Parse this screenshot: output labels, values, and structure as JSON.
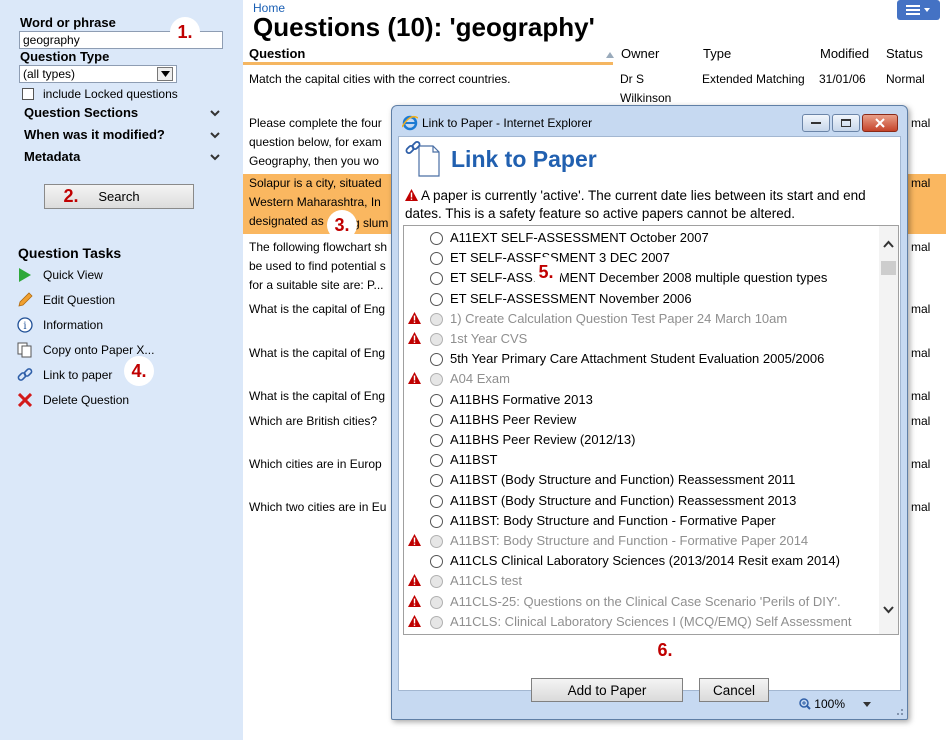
{
  "sidebar": {
    "word_label": "Word or phrase",
    "word_value": "geography",
    "type_label": "Question Type",
    "type_value": "(all types)",
    "locked_label": "include Locked questions",
    "sections": [
      "Question Sections",
      "When was it modified?",
      "Metadata"
    ],
    "search_label": "Search",
    "tasks_title": "Question Tasks",
    "tasks": [
      {
        "label": "Quick View",
        "icon": "play-icon"
      },
      {
        "label": "Edit Question",
        "icon": "pencil-icon"
      },
      {
        "label": "Information",
        "icon": "info-icon"
      },
      {
        "label": "Copy onto Paper X...",
        "icon": "copy-icon"
      },
      {
        "label": "Link to paper",
        "icon": "link-icon"
      },
      {
        "label": "Delete Question",
        "icon": "delete-x-icon"
      }
    ]
  },
  "callouts": [
    "1.",
    "2.",
    "3.",
    "4.",
    "5.",
    "6."
  ],
  "main": {
    "breadcrumb": "Home",
    "title": "Questions (10): 'geography'",
    "columns": [
      "Question",
      "Owner",
      "Type",
      "Modified",
      "Status"
    ],
    "rows": [
      {
        "q": "Match the capital cities with the correct countries.",
        "owner": "Dr S Wilkinson",
        "type": "Extended Matching",
        "modified": "31/01/06",
        "status": "Normal"
      },
      {
        "q": "Please complete the four question below, for exam Geography, then you wo",
        "status": "mal"
      },
      {
        "q": "Solapur is a city, situated Western Maharashtra, In designated as",
        "q_tail": "g slum",
        "status": "mal"
      },
      {
        "q": "The following flowchart sh be used to find potential s for a suitable site are: P...",
        "status": "mal"
      },
      {
        "q": "What is the capital of Eng",
        "status": "mal"
      },
      {
        "q": "What is the capital of Eng",
        "status": "mal"
      },
      {
        "q": "What is the capital of Eng",
        "status": "mal"
      },
      {
        "q": "Which are British cities?",
        "status": "mal"
      },
      {
        "q": "Which cities are in Europ",
        "status": "mal"
      },
      {
        "q": "Which two cities are in Eu",
        "status": "mal"
      }
    ]
  },
  "dialog": {
    "window_title": "Link to Paper - Internet Explorer",
    "heading": "Link to Paper",
    "warning": "A paper is currently 'active'. The current date lies between its start and end dates. This is a safety feature so active papers cannot be altered.",
    "papers": [
      {
        "label": "A11EXT SELF-ASSESSMENT October 2007",
        "disabled": false
      },
      {
        "label": "ET SELF-ASSESSMENT 3 DEC 2007",
        "disabled": false
      },
      {
        "label": "ET SELF-ASSESSMENT December 2008 multiple question types",
        "disabled": false
      },
      {
        "label": "ET SELF-ASSESSMENT November 2006",
        "disabled": false
      },
      {
        "label": "1) Create Calculation Question Test Paper 24 March 10am",
        "disabled": true
      },
      {
        "label": "1st Year CVS",
        "disabled": true
      },
      {
        "label": "5th Year Primary Care Attachment Student Evaluation 2005/2006",
        "disabled": false
      },
      {
        "label": "A04 Exam",
        "disabled": true
      },
      {
        "label": "A11BHS Formative 2013",
        "disabled": false
      },
      {
        "label": "A11BHS Peer Review",
        "disabled": false
      },
      {
        "label": "A11BHS Peer Review (2012/13)",
        "disabled": false
      },
      {
        "label": "A11BST",
        "disabled": false
      },
      {
        "label": "A11BST (Body Structure and Function) Reassessment 2011",
        "disabled": false
      },
      {
        "label": "A11BST (Body Structure and Function) Reassessment 2013",
        "disabled": false
      },
      {
        "label": "A11BST: Body Structure and Function - Formative Paper",
        "disabled": false
      },
      {
        "label": "A11BST: Body Structure and Function - Formative Paper 2014",
        "disabled": true
      },
      {
        "label": "A11CLS Clinical Laboratory Sciences (2013/2014 Resit exam 2014)",
        "disabled": false
      },
      {
        "label": "A11CLS test",
        "disabled": true
      },
      {
        "label": "A11CLS-25: Questions on the Clinical Case Scenario 'Perils of DIY'.",
        "disabled": true
      },
      {
        "label": "A11CLS: Clinical Laboratory Sciences I (MCQ/EMQ) Self Assessment",
        "disabled": true
      }
    ],
    "add_button": "Add to Paper",
    "cancel_button": "Cancel",
    "zoom": "100%"
  },
  "colors": {
    "sidebar_bg": "#dbe8f9",
    "selected_row": "#fab760",
    "heading_blue": "#2160b0",
    "warning_red": "#c00000"
  }
}
